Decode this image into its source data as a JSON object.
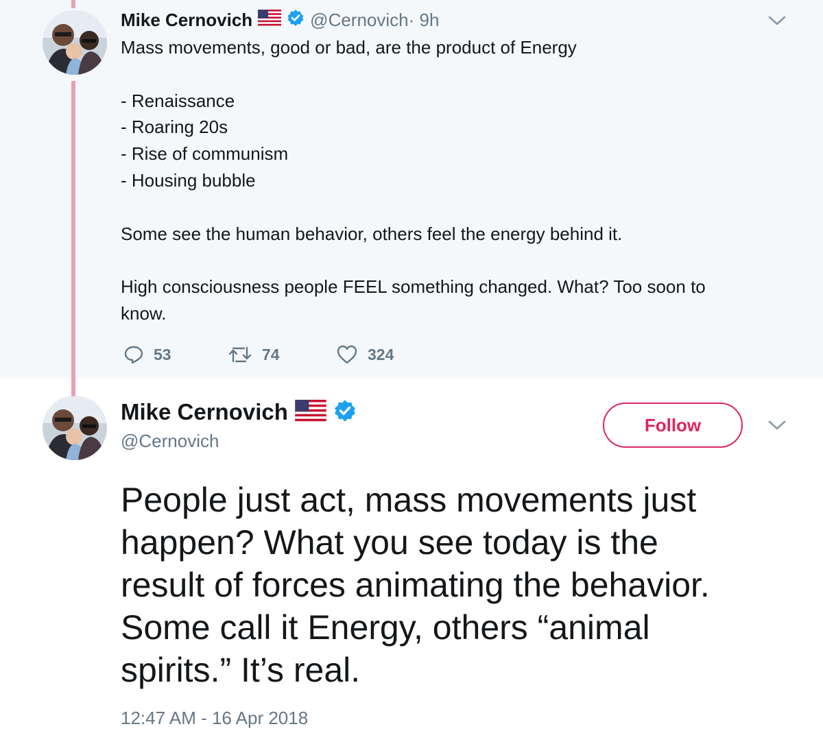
{
  "parent_tweet": {
    "author_name": "Mike Cernovich",
    "flag_emoji": "🇺🇸",
    "handle": "@Cernovich",
    "time": " · 9h",
    "lines": [
      "Mass movements, good or bad, are the product of Energy",
      "",
      "- Renaissance",
      "- Roaring 20s",
      "- Rise of communism",
      "- Housing bubble",
      "",
      "Some see the human behavior, others feel the energy behind it.",
      "",
      "High consciousness people FEEL something changed. What? Too soon to",
      "know."
    ],
    "actions": {
      "replies": "53",
      "retweets": "74",
      "likes": "324"
    },
    "icons": [
      "reply-icon",
      "retweet-icon",
      "heart-icon",
      "chevron-down-icon",
      "verified-badge-icon",
      "us-flag-icon"
    ]
  },
  "main_tweet": {
    "author_name": "Mike Cernovich",
    "handle": "@Cernovich",
    "follow_label": "Follow",
    "lines": [
      "People just act, mass movements just",
      "happen? What you see today is the",
      "result of forces animating the behavior.",
      "Some call it Energy, others “animal",
      "spirits.” It’s real."
    ],
    "timestamp": "12:47 AM - 16 Apr 2018"
  },
  "colors": {
    "thread_line": "#e8a3b2",
    "follow_accent": "#e0245e",
    "verified_blue": "#1da1f2",
    "secondary_text": "#657786",
    "parent_background": "#f5f8fa"
  }
}
